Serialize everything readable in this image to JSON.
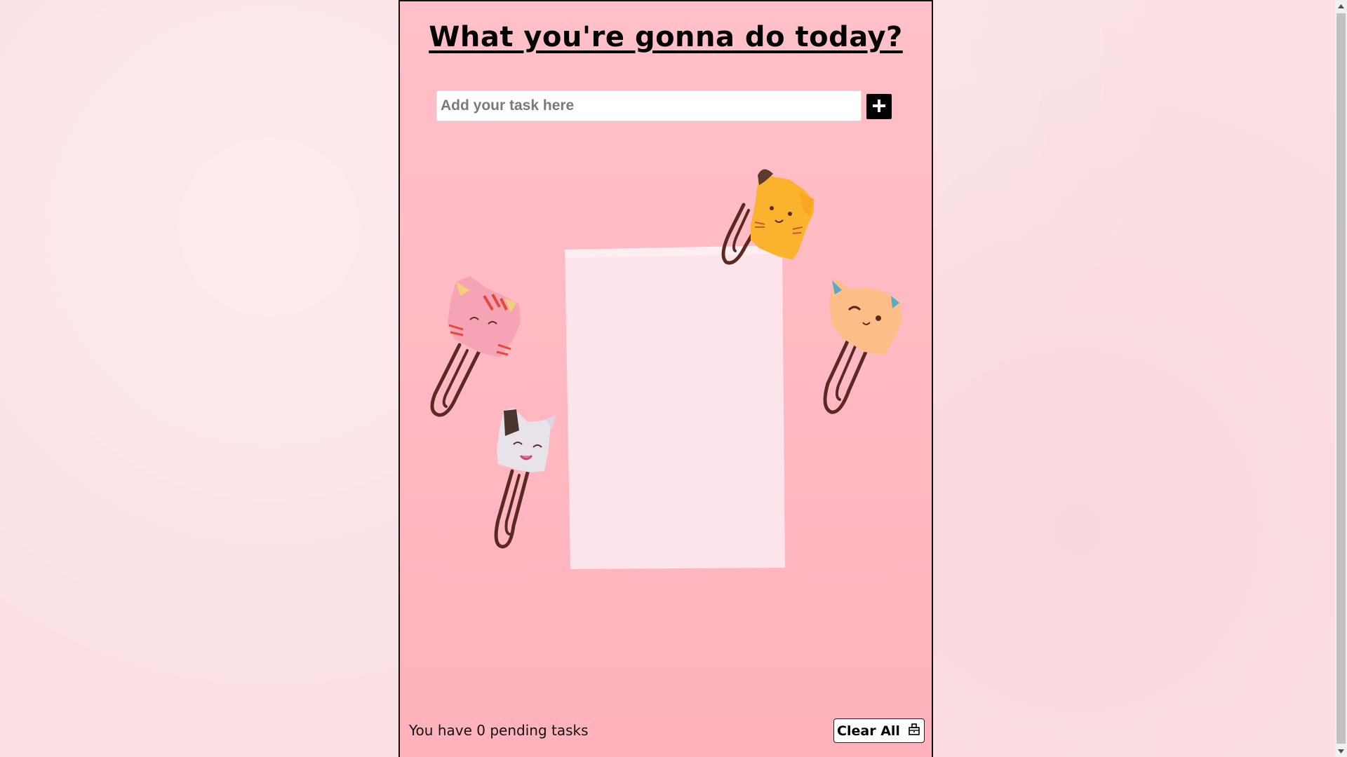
{
  "header": {
    "title": "What you're gonna do today?"
  },
  "task_input": {
    "placeholder": "Add your task here",
    "value": ""
  },
  "add_button": {
    "icon": "plus-icon"
  },
  "footer": {
    "pending_text": "You have 0 pending tasks",
    "clear_all_label": "Clear All",
    "clear_all_icon": "trash-icon"
  },
  "colors": {
    "page_background": "#fbe1e4",
    "panel_background": "#ffbac3",
    "accent": "#000000"
  }
}
